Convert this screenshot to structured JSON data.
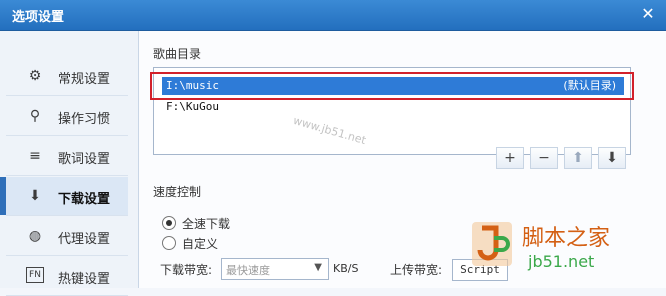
{
  "window": {
    "title": "选项设置",
    "close_glyph": "✕"
  },
  "sidebar": {
    "items": [
      {
        "label": "常规设置",
        "icon": "gear-icon",
        "glyph": "⚙",
        "active": false
      },
      {
        "label": "操作习惯",
        "icon": "pin-icon",
        "glyph": "⚲",
        "active": false
      },
      {
        "label": "歌词设置",
        "icon": "lyrics-icon",
        "glyph": "≡",
        "active": false
      },
      {
        "label": "下载设置",
        "icon": "download-icon",
        "glyph": "⬇",
        "active": true
      },
      {
        "label": "代理设置",
        "icon": "globe-icon",
        "glyph": "◍",
        "active": false
      },
      {
        "label": "热键设置",
        "icon": "hotkey-icon",
        "glyph": "FN",
        "active": false
      }
    ]
  },
  "music_dir": {
    "title": "歌曲目录",
    "rows": [
      {
        "path": "I:\\music",
        "tag": "(默认目录)",
        "selected": true
      },
      {
        "path": "F:\\KuGou",
        "tag": "",
        "selected": false
      }
    ],
    "buttons": [
      {
        "name": "add-button",
        "glyph": "+",
        "disabled": false
      },
      {
        "name": "remove-button",
        "glyph": "−",
        "disabled": false
      },
      {
        "name": "move-up-button",
        "glyph": "⬆",
        "disabled": true
      },
      {
        "name": "move-down-button",
        "glyph": "⬇",
        "disabled": false
      }
    ]
  },
  "speed": {
    "title": "速度控制",
    "options": [
      {
        "label": "全速下载",
        "checked": true
      },
      {
        "label": "自定义",
        "checked": false
      }
    ],
    "download_label": "下载带宽:",
    "download_value": "最快速度",
    "download_unit": "KB/S",
    "upload_label": "上传带宽:",
    "upload_value": "Script"
  },
  "watermark": {
    "text": "www.jb51.net"
  },
  "logo": {
    "cn": "脚本之家",
    "en": "jb51.net"
  },
  "colors": {
    "title_bar": "#236fbe",
    "selection": "#2e7bd7",
    "highlight_border": "#d2212b",
    "active_nav": "#2f6fb9"
  }
}
